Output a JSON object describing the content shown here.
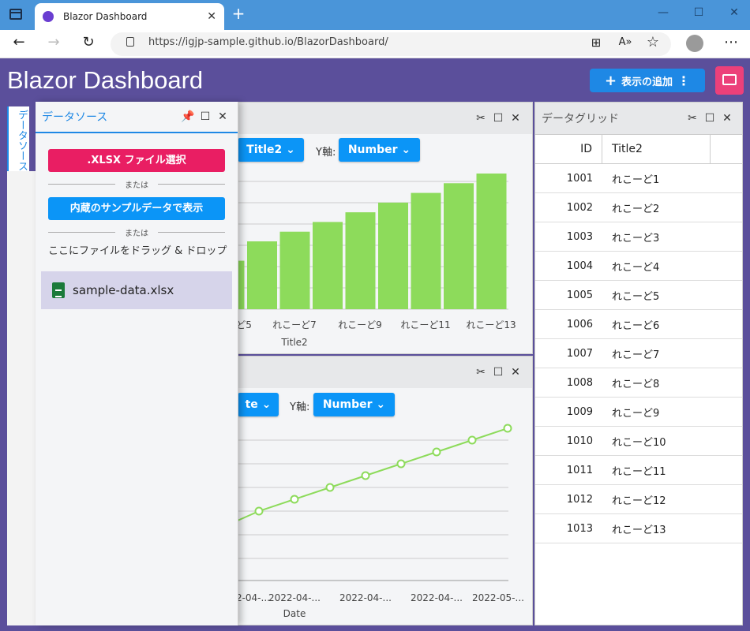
{
  "browser": {
    "tab_title": "Blazor Dashboard",
    "tab_close": "✕",
    "new_tab": "+",
    "url": "https://igjp-sample.github.io/BlazorDashboard/",
    "window_controls": [
      "—",
      "☐",
      "✕"
    ]
  },
  "app": {
    "title": "Blazor Dashboard",
    "add_button": "表示の追加",
    "side_tab": "データソース"
  },
  "datasource": {
    "title": "データソース",
    "xlsx_button": ".XLSX ファイル選択",
    "or1": "または",
    "sample_button": "内蔵のサンプルデータで表示",
    "or2": "または",
    "drop_text": "ここにファイルをドラッグ & ドロップ",
    "file_name": "sample-data.xlsx"
  },
  "bar_panel": {
    "x_button": "Title2",
    "y_label": "Y軸:",
    "y_button": "Number"
  },
  "line_panel": {
    "x_button": "te",
    "y_label": "Y軸:",
    "y_button": "Number"
  },
  "grid": {
    "title": "データグリッド",
    "col_id": "ID",
    "col_title": "Title2",
    "rows": [
      {
        "id": "1001",
        "title": "れこーど1"
      },
      {
        "id": "1002",
        "title": "れこーど2"
      },
      {
        "id": "1003",
        "title": "れこーど3"
      },
      {
        "id": "1004",
        "title": "れこーど4"
      },
      {
        "id": "1005",
        "title": "れこーど5"
      },
      {
        "id": "1006",
        "title": "れこーど6"
      },
      {
        "id": "1007",
        "title": "れこーど7"
      },
      {
        "id": "1008",
        "title": "れこーど8"
      },
      {
        "id": "1009",
        "title": "れこーど9"
      },
      {
        "id": "1010",
        "title": "れこーど10"
      },
      {
        "id": "1011",
        "title": "れこーど11"
      },
      {
        "id": "1012",
        "title": "れこーど12"
      },
      {
        "id": "1013",
        "title": "れこーど13"
      }
    ]
  },
  "colors": {
    "header": "#5b4f9b",
    "accent": "#0b95f7",
    "pink": "#e91e63",
    "bar": "#8ddb5b"
  },
  "chart_data": [
    {
      "type": "bar",
      "xlabel": "Title2",
      "ylabel": "",
      "categories": [
        "5",
        "6",
        "7",
        "8",
        "9",
        "10",
        "11",
        "12",
        "13"
      ],
      "tick_labels": [
        "ど5",
        "れこーど7",
        "れこーど9",
        "れこーど11",
        "れこーど13"
      ],
      "values": [
        5,
        7,
        8,
        9,
        10,
        11,
        12,
        13,
        14
      ],
      "grid": true
    },
    {
      "type": "line",
      "xlabel": "Date",
      "ylabel": "",
      "tick_labels": [
        "2022-04-...",
        "2022-04-...",
        "2022-04-...",
        "2022-04-...",
        "2022-05-..."
      ],
      "values": [
        6,
        7,
        8,
        9,
        10,
        11,
        12,
        13
      ],
      "grid": true
    }
  ]
}
